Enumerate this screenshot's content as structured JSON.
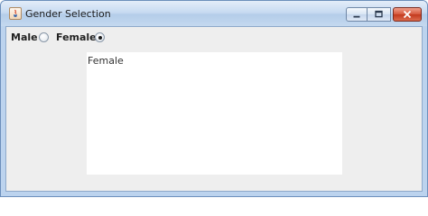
{
  "window": {
    "title": "Gender Selection"
  },
  "form": {
    "male_label": "Male",
    "female_label": "Female",
    "selected": "female"
  },
  "output": {
    "text": "Female"
  }
}
